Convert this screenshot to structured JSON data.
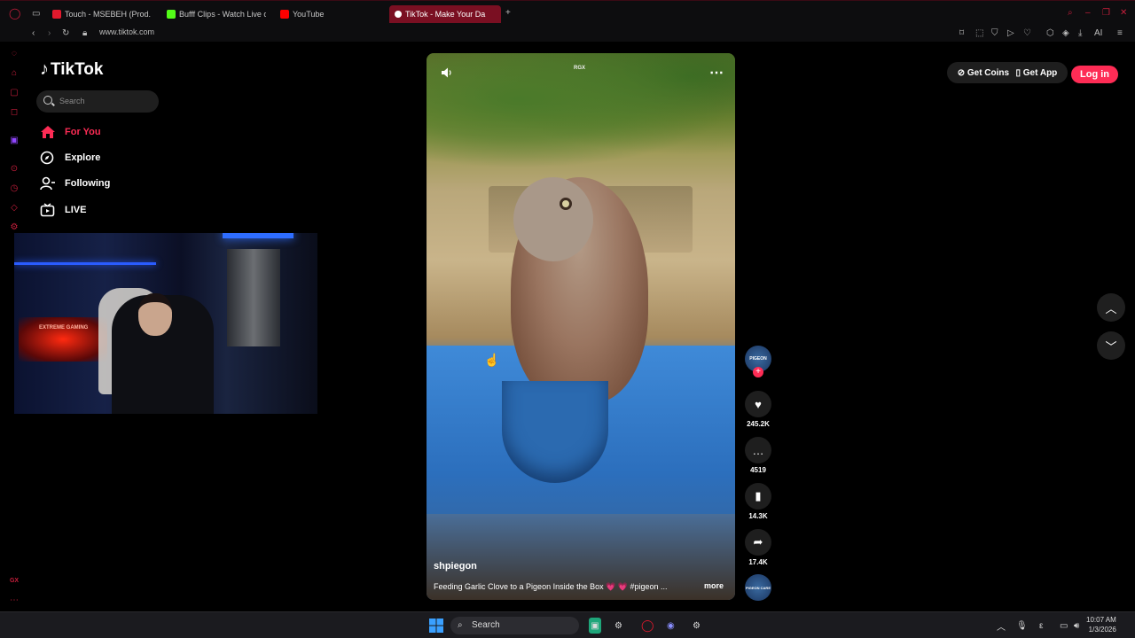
{
  "browser": {
    "tabs": [
      {
        "label": "Touch - MSEBEH (Prod. SI",
        "favicon_color": "#e3192d"
      },
      {
        "label": "Bufff Clips - Watch Live c",
        "favicon_color": "#53fc18"
      },
      {
        "label": "YouTube",
        "favicon_color": "#ff0000"
      },
      {
        "label": "TikTok - Make Your Da",
        "favicon_color": "#ffffff",
        "active": true
      }
    ],
    "url": "www.tiktok.com",
    "toolbar_ai": "AI"
  },
  "sidebar": {
    "logo": "TikTok",
    "search_placeholder": "Search",
    "nav": [
      {
        "label": "For You",
        "icon": "home-icon",
        "active": true
      },
      {
        "label": "Explore",
        "icon": "compass-icon"
      },
      {
        "label": "Following",
        "icon": "following-icon"
      },
      {
        "label": "LIVE",
        "icon": "live-icon"
      }
    ]
  },
  "webcam": {
    "sign_text": "EXTREME GAMING"
  },
  "video": {
    "watermark": "RGX",
    "author": "shpiegon",
    "caption": "Feeding Garlic Clove to a Pigeon Inside the Box 💗 💗 #pigeon ...",
    "more": "more"
  },
  "actions": {
    "avatar_label": "PIGEON",
    "likes": "245.2K",
    "comments": "4519",
    "saves": "14.3K",
    "shares": "17.4K",
    "music_label": "PIGEON CARE"
  },
  "header": {
    "get_coins": "Get Coins",
    "get_app": "Get App",
    "login": "Log in"
  },
  "taskbar": {
    "search": "Search",
    "lang": "ε",
    "time": "10:07 AM",
    "date": "1/3/2026"
  },
  "colors": {
    "accent": "#fe2c55",
    "opera_red": "#c81e3c"
  }
}
